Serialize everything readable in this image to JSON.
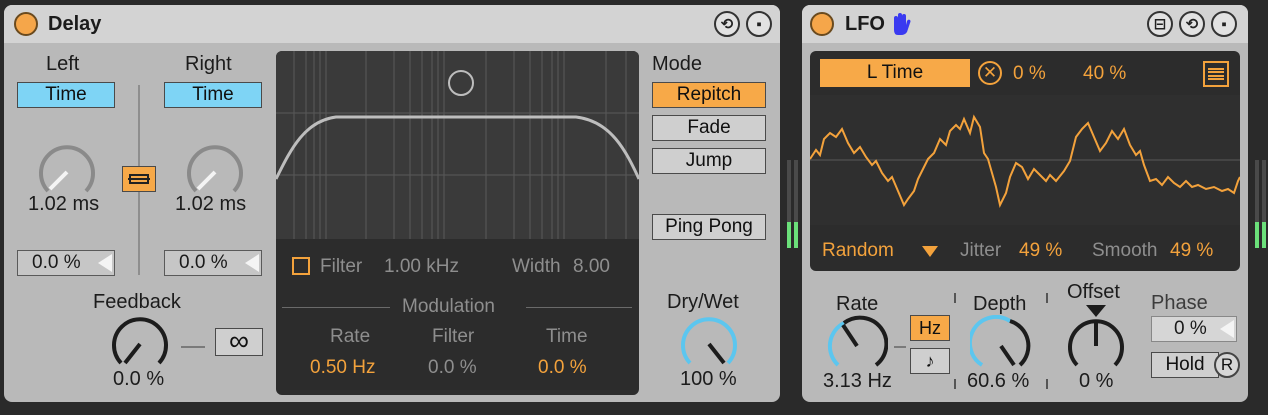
{
  "delay": {
    "title": "Delay",
    "left_label": "Left",
    "right_label": "Right",
    "left_sync_label": "Time",
    "right_sync_label": "Time",
    "left_time": "1.02 ms",
    "right_time": "1.02 ms",
    "left_offset": "0.0 %",
    "right_offset": "0.0 %",
    "feedback_label": "Feedback",
    "feedback_value": "0.0 %",
    "freeze_symbol": "∞",
    "mode_label": "Mode",
    "modes": [
      "Repitch",
      "Fade",
      "Jump"
    ],
    "active_mode": "Repitch",
    "ping_pong_label": "Ping Pong",
    "filter_label": "Filter",
    "filter_freq": "1.00 kHz",
    "width_label": "Width",
    "width_value": "8.00",
    "modulation_label": "Modulation",
    "mod_rate_label": "Rate",
    "mod_filter_label": "Filter",
    "mod_time_label": "Time",
    "mod_rate_value": "0.50 Hz",
    "mod_filter_value": "0.0 %",
    "mod_time_value": "0.0 %",
    "drywet_label": "Dry/Wet",
    "drywet_value": "100 %"
  },
  "lfo": {
    "title": "LFO",
    "map_target": "L Time",
    "min_value": "0 %",
    "max_value": "40 %",
    "waveform": "Random",
    "jitter_label": "Jitter",
    "jitter_value": "49 %",
    "smooth_label": "Smooth",
    "smooth_value": "49 %",
    "rate_label": "Rate",
    "rate_value": "3.13 Hz",
    "hz_label": "Hz",
    "note_symbol": "♪",
    "depth_label": "Depth",
    "depth_value": "60.6 %",
    "offset_label": "Offset",
    "offset_value": "0 %",
    "phase_label": "Phase",
    "phase_value": "0 %",
    "hold_label": "Hold",
    "r_label": "R"
  },
  "colors": {
    "accent_orange": "#f7a948",
    "sync_blue": "#7ed4f5",
    "knob_blue": "#5cc6ef",
    "meter_green": "#6be07a"
  }
}
